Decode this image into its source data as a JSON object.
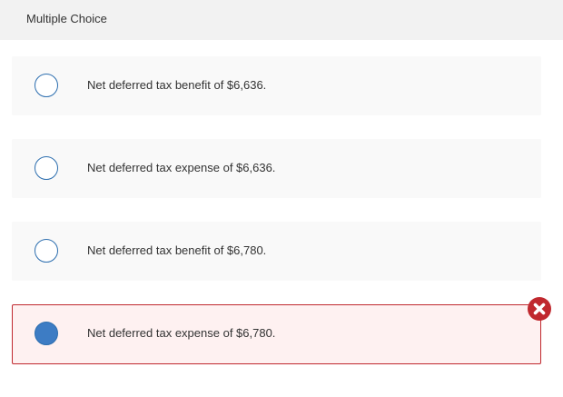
{
  "header": {
    "title": "Multiple Choice"
  },
  "options": [
    {
      "label": "Net deferred tax benefit of $6,636.",
      "selected": false
    },
    {
      "label": "Net deferred tax expense of $6,636.",
      "selected": false
    },
    {
      "label": "Net deferred tax benefit of $6,780.",
      "selected": false
    },
    {
      "label": "Net deferred tax expense of $6,780.",
      "selected": true,
      "status": "incorrect"
    }
  ],
  "colors": {
    "radio_border": "#2c6eaf",
    "radio_selected_fill": "#3d7cc4",
    "error_red": "#c0282e",
    "error_background": "#fef1f1",
    "option_background": "#f9f9f9"
  },
  "icons": {
    "incorrect_marker": "close-circle-icon"
  }
}
